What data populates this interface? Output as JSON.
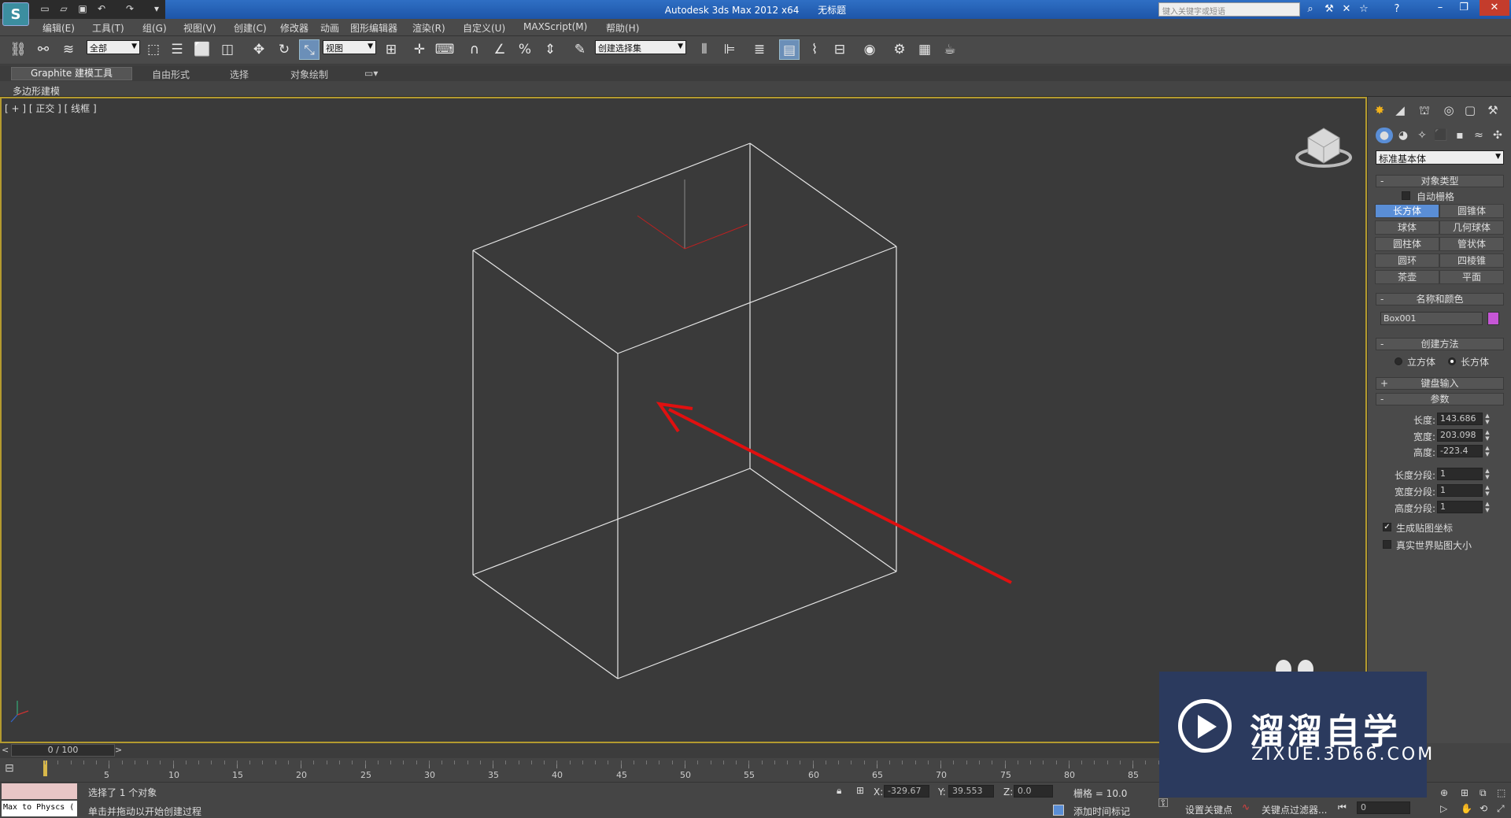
{
  "window": {
    "app_title": "Autodesk 3ds Max  2012 x64",
    "doc_title": "无标题",
    "search_placeholder": "键入关键字或短语",
    "logo_glyph": "S"
  },
  "menu": [
    "编辑(E)",
    "工具(T)",
    "组(G)",
    "视图(V)",
    "创建(C)",
    "修改器",
    "动画",
    "图形编辑器",
    "渲染(R)",
    "自定义(U)",
    "MAXScript(M)",
    "帮助(H)"
  ],
  "toolbar": {
    "selection_filter": "全部",
    "reference_coord": "视图",
    "named_selection": "创建选择集"
  },
  "ribbon": {
    "tabs": [
      "Graphite 建模工具",
      "自由形式",
      "选择",
      "对象绘制"
    ],
    "sub_label": "多边形建模"
  },
  "viewport": {
    "label": "[ + ] [ 正交 ] [ 线框 ]"
  },
  "command_panel": {
    "category": "标准基本体",
    "object_type": {
      "title": "对象类型",
      "autogrid": "自动栅格",
      "buttons": [
        "长方体",
        "圆锥体",
        "球体",
        "几何球体",
        "圆柱体",
        "管状体",
        "圆环",
        "四棱锥",
        "茶壶",
        "平面"
      ]
    },
    "name_color": {
      "title": "名称和颜色",
      "name": "Box001",
      "color": "#c656d6"
    },
    "creation_method": {
      "title": "创建方法",
      "options": [
        "立方体",
        "长方体"
      ]
    },
    "keyboard_entry": {
      "title": "键盘输入"
    },
    "parameters": {
      "title": "参数",
      "length_label": "长度:",
      "length": "143.686",
      "width_label": "宽度:",
      "width": "203.098",
      "height_label": "高度:",
      "height": "-223.4",
      "length_segs_label": "长度分段:",
      "length_segs": "1",
      "width_segs_label": "宽度分段:",
      "width_segs": "1",
      "height_segs_label": "高度分段:",
      "height_segs": "1",
      "gen_mapping": "生成贴图坐标",
      "real_world": "真实世界贴图大小"
    }
  },
  "timeline": {
    "frame_display": "0 / 100",
    "ticks": [
      "5",
      "10",
      "15",
      "20",
      "25",
      "30",
      "35",
      "40",
      "45",
      "50",
      "55",
      "60",
      "65",
      "70",
      "75",
      "80",
      "85"
    ]
  },
  "status": {
    "maxscript_text": "Max to Physcs (",
    "selection_status": "选择了 1 个对象",
    "prompt": "单击并拖动以开始创建过程",
    "x_label": "X:",
    "x": "-329.67",
    "y_label": "Y:",
    "y": "39.553",
    "z_label": "Z:",
    "z": "0.0",
    "grid": "栅格 = 10.0",
    "add_time_tag": "添加时间标记",
    "set_key": "设置关键点",
    "key_filters": "关键点过滤器...",
    "frame_field": "0"
  },
  "watermark": {
    "title": "溜溜自学",
    "url": "ZIXUE.3D66.COM"
  },
  "colors": {
    "arrow": "#e01010",
    "viewport_border": "#b39a2f",
    "active_button": "#5a8ed6"
  }
}
